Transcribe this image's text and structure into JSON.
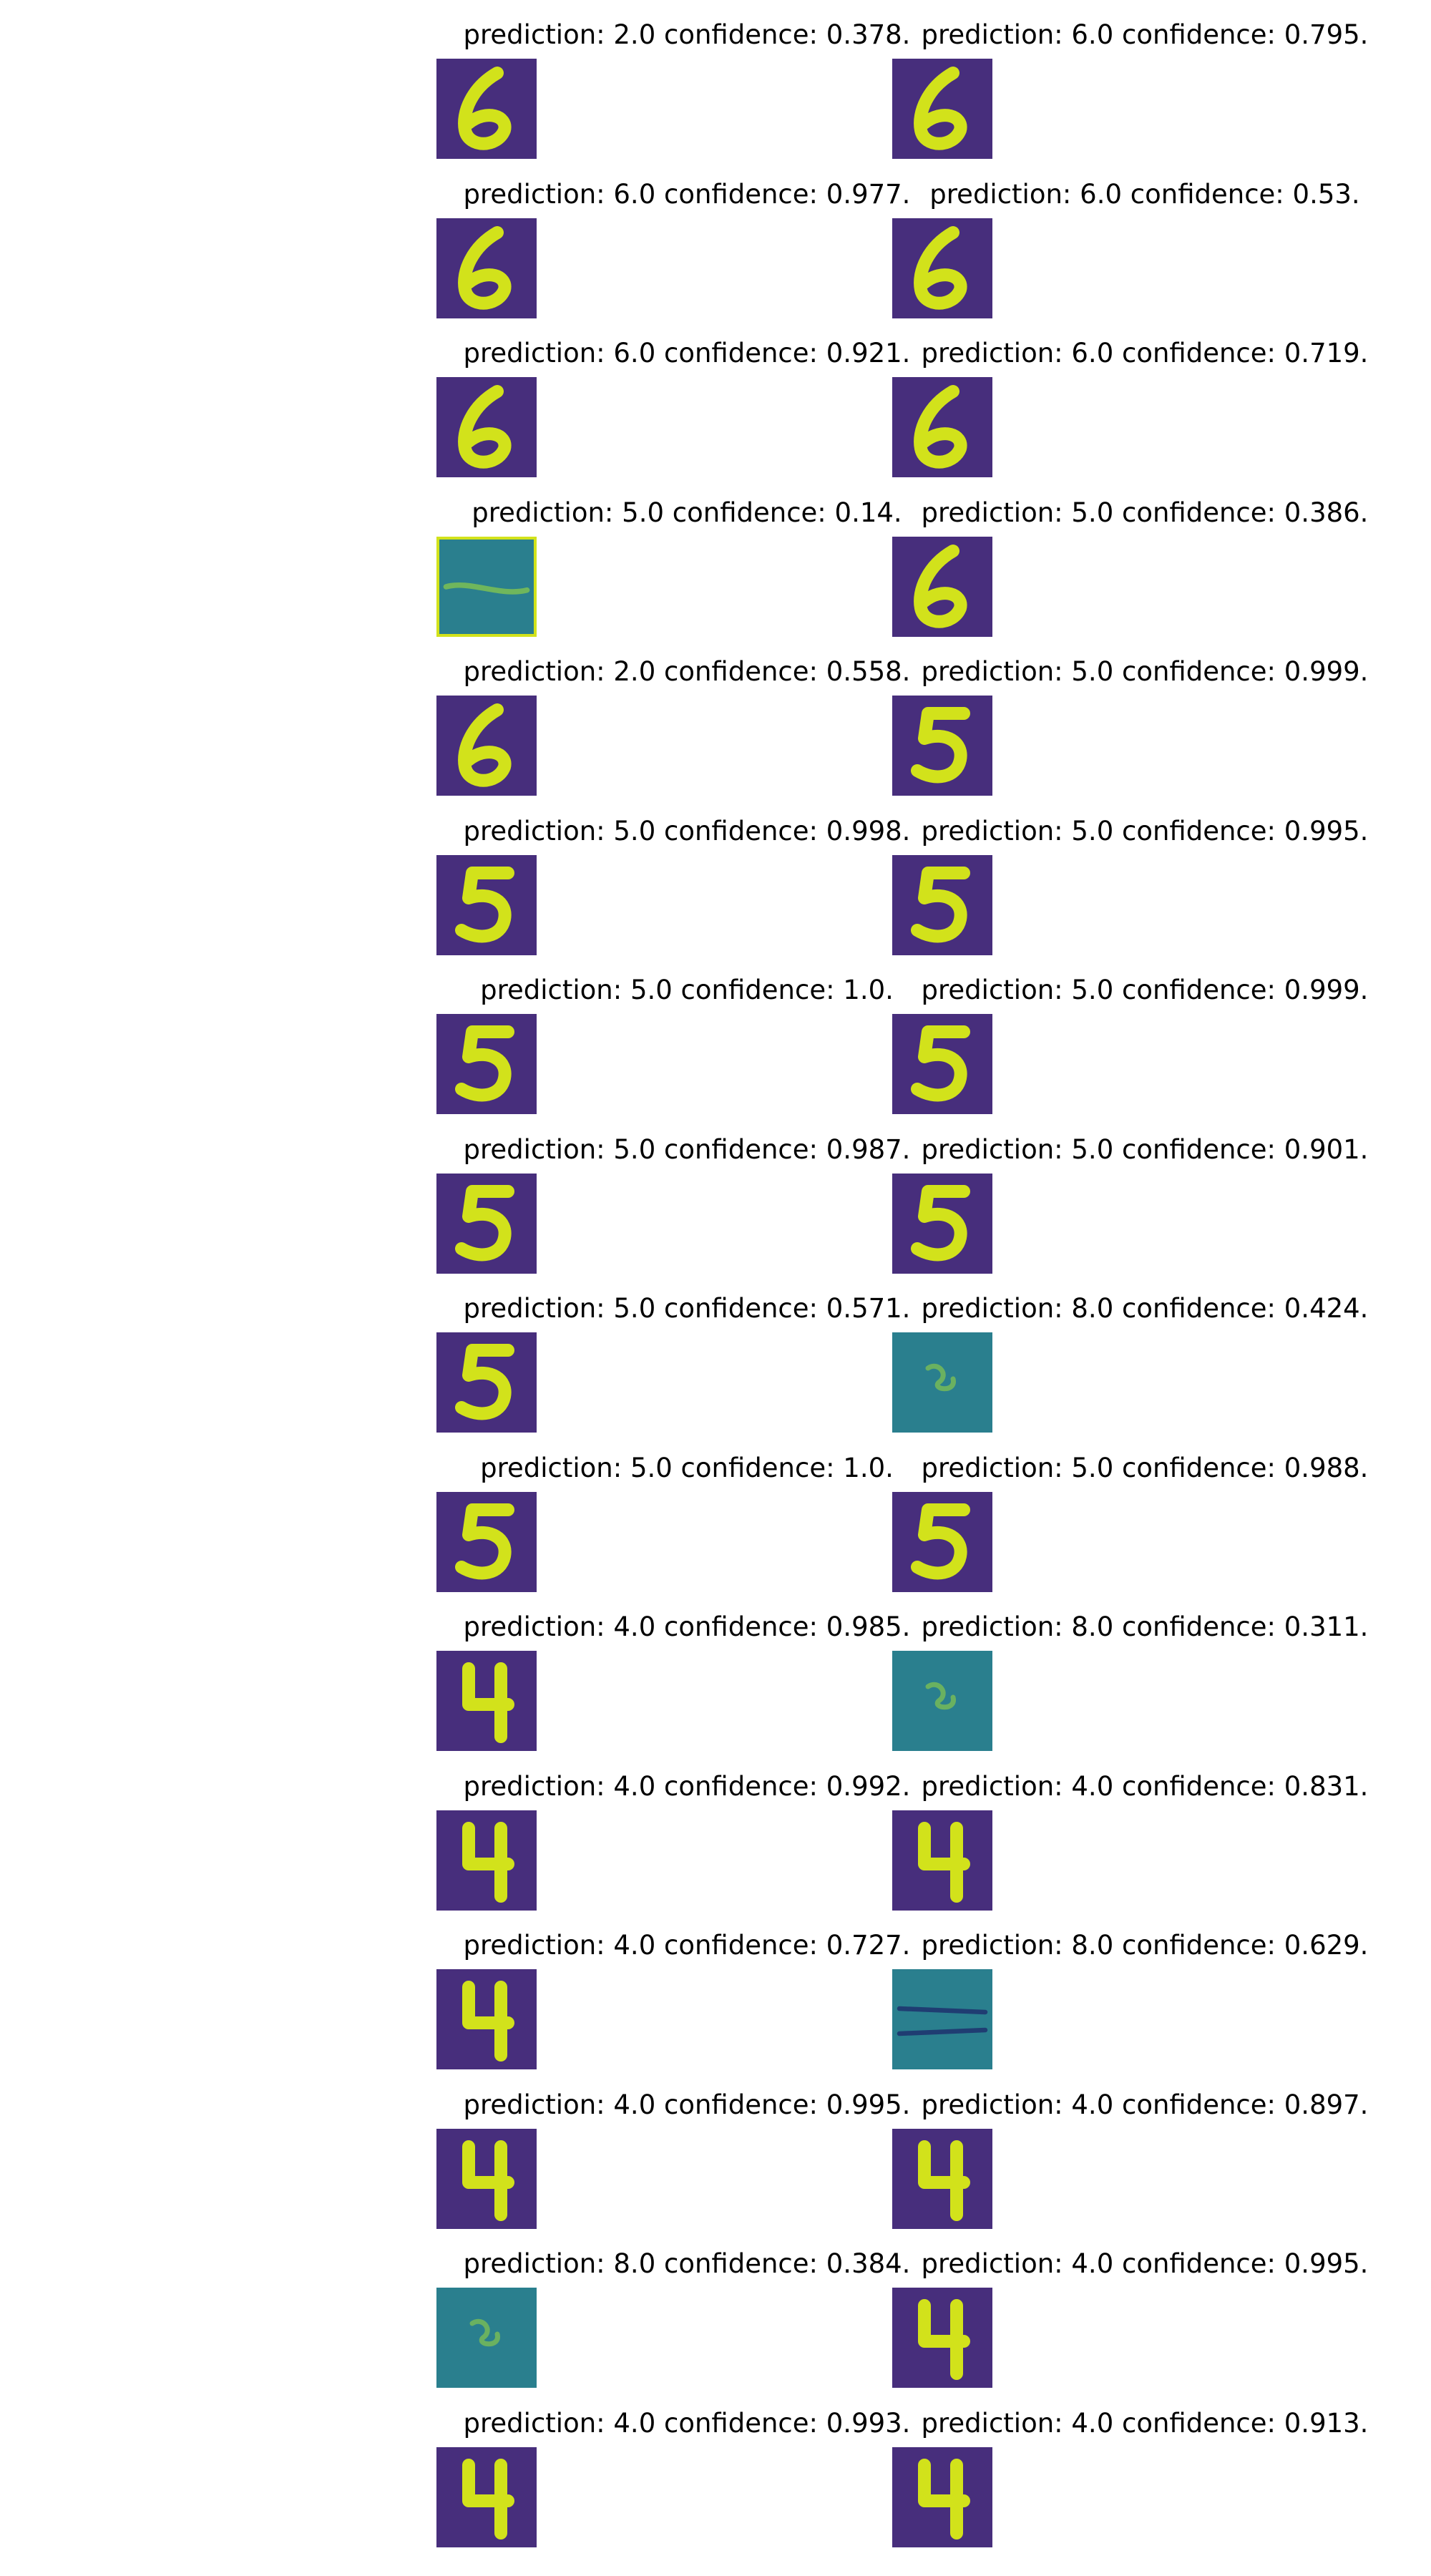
{
  "chart_data": {
    "type": "image-grid",
    "panels": [
      {
        "title": "prediction: 2.0 confidence: 0.378.",
        "image": "digit-6",
        "prediction": 2.0,
        "confidence": 0.378
      },
      {
        "title": "prediction: 6.0 confidence: 0.795.",
        "image": "digit-6",
        "prediction": 6.0,
        "confidence": 0.795
      },
      {
        "title": "prediction: 6.0 confidence: 0.977.",
        "image": "digit-6",
        "prediction": 6.0,
        "confidence": 0.977
      },
      {
        "title": "prediction: 6.0 confidence: 0.53.",
        "image": "digit-6",
        "prediction": 6.0,
        "confidence": 0.53
      },
      {
        "title": "prediction: 6.0 confidence: 0.921.",
        "image": "digit-6",
        "prediction": 6.0,
        "confidence": 0.921
      },
      {
        "title": "prediction: 6.0 confidence: 0.719.",
        "image": "digit-6",
        "prediction": 6.0,
        "confidence": 0.719
      },
      {
        "title": "prediction: 5.0 confidence: 0.14.",
        "image": "noise-stripe",
        "prediction": 5.0,
        "confidence": 0.14
      },
      {
        "title": "prediction: 5.0 confidence: 0.386.",
        "image": "digit-6",
        "prediction": 5.0,
        "confidence": 0.386
      },
      {
        "title": "prediction: 2.0 confidence: 0.558.",
        "image": "digit-6",
        "prediction": 2.0,
        "confidence": 0.558
      },
      {
        "title": "prediction: 5.0 confidence: 0.999.",
        "image": "digit-5",
        "prediction": 5.0,
        "confidence": 0.999
      },
      {
        "title": "prediction: 5.0 confidence: 0.998.",
        "image": "digit-5",
        "prediction": 5.0,
        "confidence": 0.998
      },
      {
        "title": "prediction: 5.0 confidence: 0.995.",
        "image": "digit-5",
        "prediction": 5.0,
        "confidence": 0.995
      },
      {
        "title": "prediction: 5.0 confidence: 1.0.",
        "image": "digit-5",
        "prediction": 5.0,
        "confidence": 1.0
      },
      {
        "title": "prediction: 5.0 confidence: 0.999.",
        "image": "digit-5",
        "prediction": 5.0,
        "confidence": 0.999
      },
      {
        "title": "prediction: 5.0 confidence: 0.987.",
        "image": "digit-5",
        "prediction": 5.0,
        "confidence": 0.987
      },
      {
        "title": "prediction: 5.0 confidence: 0.901.",
        "image": "digit-5",
        "prediction": 5.0,
        "confidence": 0.901
      },
      {
        "title": "prediction: 5.0 confidence: 0.571.",
        "image": "digit-5",
        "prediction": 5.0,
        "confidence": 0.571
      },
      {
        "title": "prediction: 8.0 confidence: 0.424.",
        "image": "noise-blob",
        "prediction": 8.0,
        "confidence": 0.424
      },
      {
        "title": "prediction: 5.0 confidence: 1.0.",
        "image": "digit-5",
        "prediction": 5.0,
        "confidence": 1.0
      },
      {
        "title": "prediction: 5.0 confidence: 0.988.",
        "image": "digit-5",
        "prediction": 5.0,
        "confidence": 0.988
      },
      {
        "title": "prediction: 4.0 confidence: 0.985.",
        "image": "digit-4",
        "prediction": 4.0,
        "confidence": 0.985
      },
      {
        "title": "prediction: 8.0 confidence: 0.311.",
        "image": "noise-blob",
        "prediction": 8.0,
        "confidence": 0.311
      },
      {
        "title": "prediction: 4.0 confidence: 0.992.",
        "image": "digit-4",
        "prediction": 4.0,
        "confidence": 0.992
      },
      {
        "title": "prediction: 4.0 confidence: 0.831.",
        "image": "digit-4",
        "prediction": 4.0,
        "confidence": 0.831
      },
      {
        "title": "prediction: 4.0 confidence: 0.727.",
        "image": "digit-4",
        "prediction": 4.0,
        "confidence": 0.727
      },
      {
        "title": "prediction: 8.0 confidence: 0.629.",
        "image": "noise-lines",
        "prediction": 8.0,
        "confidence": 0.629
      },
      {
        "title": "prediction: 4.0 confidence: 0.995.",
        "image": "digit-4",
        "prediction": 4.0,
        "confidence": 0.995
      },
      {
        "title": "prediction: 4.0 confidence: 0.897.",
        "image": "digit-4",
        "prediction": 4.0,
        "confidence": 0.897
      },
      {
        "title": "prediction: 8.0 confidence: 0.384.",
        "image": "noise-blob",
        "prediction": 8.0,
        "confidence": 0.384
      },
      {
        "title": "prediction: 4.0 confidence: 0.995.",
        "image": "digit-4",
        "prediction": 4.0,
        "confidence": 0.995
      },
      {
        "title": "prediction: 4.0 confidence: 0.993.",
        "image": "digit-4",
        "prediction": 4.0,
        "confidence": 0.993
      },
      {
        "title": "prediction: 4.0 confidence: 0.913.",
        "image": "digit-4",
        "prediction": 4.0,
        "confidence": 0.913
      }
    ]
  },
  "colors": {
    "background": "#ffffff",
    "text": "#000000",
    "image_bg": "#472e7c",
    "image_bg_noise": "#2a7f8e",
    "digit_stroke": "#d2e21b",
    "highlight": "#9fda3a"
  }
}
